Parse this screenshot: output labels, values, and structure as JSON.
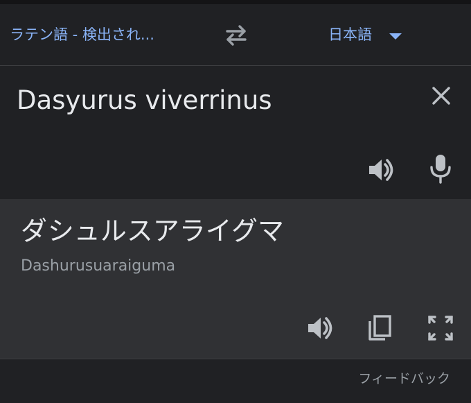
{
  "language_bar": {
    "source_language": "ラテン語 - 検出され...",
    "target_language": "日本語",
    "swap_icon": "swap-arrows-icon",
    "dropdown_icon": "caret-down-icon"
  },
  "input": {
    "text": "Dasyurus viverrinus",
    "icons": [
      "close-icon",
      "speaker-icon",
      "microphone-icon"
    ]
  },
  "output": {
    "translation": "ダシュルスアライグマ",
    "transliteration": "Dashurusuaraiguma",
    "icons": [
      "speaker-icon",
      "copy-icon",
      "fullscreen-icon"
    ]
  },
  "footer": {
    "feedback_label": "フィードバック"
  },
  "colors": {
    "background": "#202124",
    "output_background": "#303134",
    "accent": "#8ab4f8",
    "text_primary": "#e8eaed",
    "text_secondary": "#9aa0a6"
  }
}
